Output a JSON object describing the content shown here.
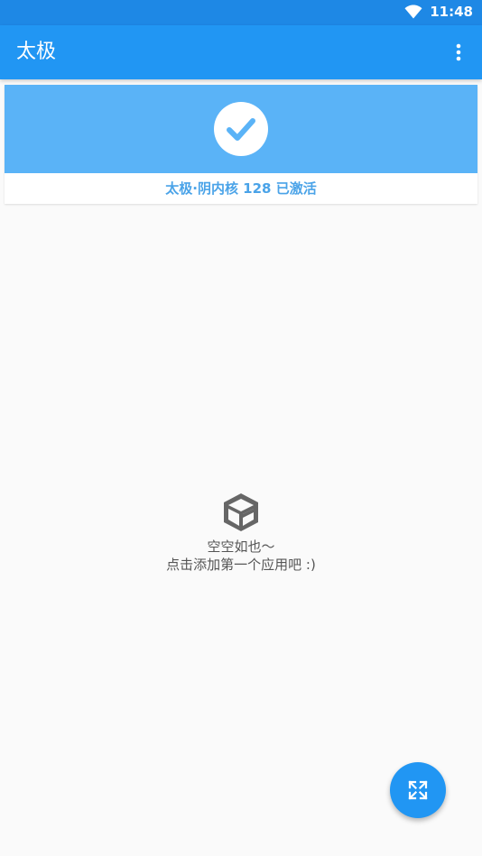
{
  "status_bar": {
    "time": "11:48",
    "wifi_icon": "wifi-icon"
  },
  "app_bar": {
    "title": "太极",
    "menu_icon": "more-vert-icon"
  },
  "status_card": {
    "icon": "check-icon",
    "status_text": "太极·阴内核 128 已激活"
  },
  "empty_state": {
    "icon": "box-icon",
    "title": "空空如也～",
    "hint": "点击添加第一个应用吧 :)"
  },
  "fab": {
    "icon": "expand-icon"
  },
  "colors": {
    "primary": "#2196f3",
    "primary_dark": "#1e88e5",
    "banner": "#5ab3f7",
    "status_text": "#4aa3e8",
    "background": "#fafafa"
  }
}
